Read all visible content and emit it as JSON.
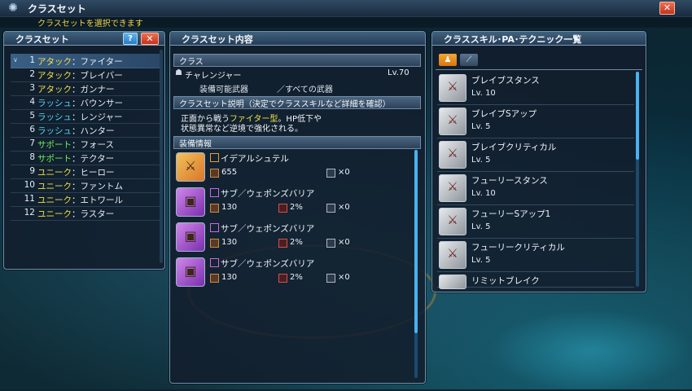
{
  "window": {
    "title": "クラスセット",
    "subtitle": "クラスセットを選択できます"
  },
  "left_panel": {
    "title": "クラスセット",
    "help_label": "?",
    "close_label": "✕",
    "rows": [
      {
        "num": "1",
        "type": "アタック",
        "name": "ファイター",
        "type_color": "#f3e24a",
        "selected": true
      },
      {
        "num": "2",
        "type": "アタック",
        "name": "ブレイバー",
        "type_color": "#f3e24a"
      },
      {
        "num": "3",
        "type": "アタック",
        "name": "ガンナー",
        "type_color": "#f3e24a"
      },
      {
        "num": "4",
        "type": "ラッシュ",
        "name": "バウンサー",
        "type_color": "#5ad6f5"
      },
      {
        "num": "5",
        "type": "ラッシュ",
        "name": "レンジャー",
        "type_color": "#5ad6f5"
      },
      {
        "num": "6",
        "type": "ラッシュ",
        "name": "ハンター",
        "type_color": "#5ad6f5"
      },
      {
        "num": "7",
        "type": "サポート",
        "name": "フォース",
        "type_color": "#6ef25c"
      },
      {
        "num": "8",
        "type": "サポート",
        "name": "テクター",
        "type_color": "#6ef25c"
      },
      {
        "num": "9",
        "type": "ユニーク",
        "name": "ヒーロー",
        "type_color": "#f3e24a"
      },
      {
        "num": "10",
        "type": "ユニーク",
        "name": "ファントム",
        "type_color": "#f3e24a"
      },
      {
        "num": "11",
        "type": "ユニーク",
        "name": "エトワール",
        "type_color": "#f3e24a"
      },
      {
        "num": "12",
        "type": "ユニーク",
        "name": "ラスター",
        "type_color": "#f3e24a"
      }
    ]
  },
  "middle_panel": {
    "title": "クラスセット内容",
    "class_section": "クラス",
    "class_name": "チャレンジャー",
    "class_level": "Lv.70",
    "weapon_label": "装備可能武器",
    "weapon_value": "／すべての武器",
    "desc_section": "クラスセット説明（決定でクラススキルなど詳細を確認）",
    "desc_line1_a": "正面から戦う",
    "desc_line1_b": "ファイター型",
    "desc_line1_c": "。HP低下や",
    "desc_line2": "状態異常など逆境で強化される。",
    "equip_section": "装備情報",
    "equipment": [
      {
        "name": "イデアルシュテル",
        "atk": "655",
        "stat2": "",
        "slots": "×0",
        "icon": "sword-icon",
        "color": "orange"
      },
      {
        "name": "サブ／ウェポンズバリア",
        "atk": "130",
        "stat2": "2%",
        "slots": "×0",
        "icon": "barrier-icon",
        "color": "purple"
      },
      {
        "name": "サブ／ウェポンズバリア",
        "atk": "130",
        "stat2": "2%",
        "slots": "×0",
        "icon": "barrier-icon",
        "color": "purple"
      },
      {
        "name": "サブ／ウェポンズバリア",
        "atk": "130",
        "stat2": "2%",
        "slots": "×0",
        "icon": "barrier-icon",
        "color": "purple"
      }
    ]
  },
  "right_panel": {
    "title": "クラススキル･PA･テクニック一覧",
    "skills": [
      {
        "name": "ブレイブスタンス",
        "level": "Lv. 10"
      },
      {
        "name": "ブレイブSアップ",
        "level": "Lv. 5"
      },
      {
        "name": "ブレイブクリティカル",
        "level": "Lv. 5"
      },
      {
        "name": "フューリースタンス",
        "level": "Lv. 10"
      },
      {
        "name": "フューリーSアップ1",
        "level": "Lv. 5"
      },
      {
        "name": "フューリークリティカル",
        "level": "Lv. 5"
      },
      {
        "name": "リミットブレイク",
        "level": ""
      }
    ]
  },
  "colors": {
    "accent_yellow": "#f3e24a",
    "accent_cyan": "#5ad6f5",
    "accent_green": "#6ef25c",
    "close_red": "#d8452a"
  }
}
